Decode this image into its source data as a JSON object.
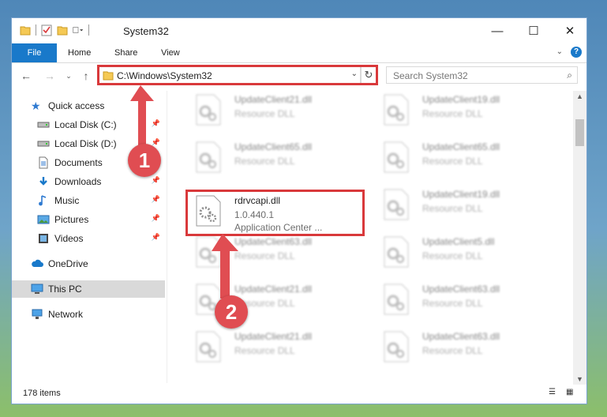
{
  "window": {
    "title": "System32",
    "minimize": "—",
    "maximize": "☐",
    "close": "✕"
  },
  "ribbon": {
    "file": "File",
    "home": "Home",
    "share": "Share",
    "view": "View"
  },
  "nav": {
    "address": "C:\\Windows\\System32",
    "search_placeholder": "Search System32"
  },
  "sidebar": {
    "quick_access": "Quick access",
    "items": [
      {
        "label": "Local Disk (C:)",
        "icon": "drive-icon",
        "pinned": true
      },
      {
        "label": "Local Disk (D:)",
        "icon": "drive-icon",
        "pinned": true
      },
      {
        "label": "Documents",
        "icon": "documents-icon",
        "pinned": true
      },
      {
        "label": "Downloads",
        "icon": "downloads-icon",
        "pinned": true
      },
      {
        "label": "Music",
        "icon": "music-icon",
        "pinned": true
      },
      {
        "label": "Pictures",
        "icon": "pictures-icon",
        "pinned": true
      },
      {
        "label": "Videos",
        "icon": "videos-icon",
        "pinned": true
      }
    ],
    "onedrive": "OneDrive",
    "this_pc": "This PC",
    "network": "Network"
  },
  "files": {
    "highlight": {
      "name": "rdrvcapi.dll",
      "version": "1.0.440.1",
      "company": "Application Center ..."
    },
    "blurred": [
      {
        "name": "UpdateClient21.dll",
        "type": "Resource DLL"
      },
      {
        "name": "UpdateClient19.dll",
        "type": "Resource DLL"
      },
      {
        "name": "UpdateClient65.dll",
        "type": "Resource DLL"
      },
      {
        "name": "UpdateClient65.dll",
        "type": "Resource DLL"
      },
      {
        "name": "UpdateClient19.dll",
        "type": "Resource DLL"
      },
      {
        "name": "UpdateClient63.dll",
        "type": "Resource DLL"
      },
      {
        "name": "UpdateClient5.dll",
        "type": "Resource DLL"
      },
      {
        "name": "UpdateClient21.dll",
        "type": "Resource DLL"
      },
      {
        "name": "UpdateClient63.dll",
        "type": "Resource DLL"
      },
      {
        "name": "UpdateClient21.dll",
        "type": "Resource DLL"
      },
      {
        "name": "UpdateClient63.dll",
        "type": "Resource DLL"
      }
    ]
  },
  "status": {
    "items": "178 items"
  },
  "callouts": {
    "one": "1",
    "two": "2"
  },
  "colors": {
    "accent": "#1979ca",
    "highlight_red": "#d9393b",
    "callout": "#e04d52"
  }
}
